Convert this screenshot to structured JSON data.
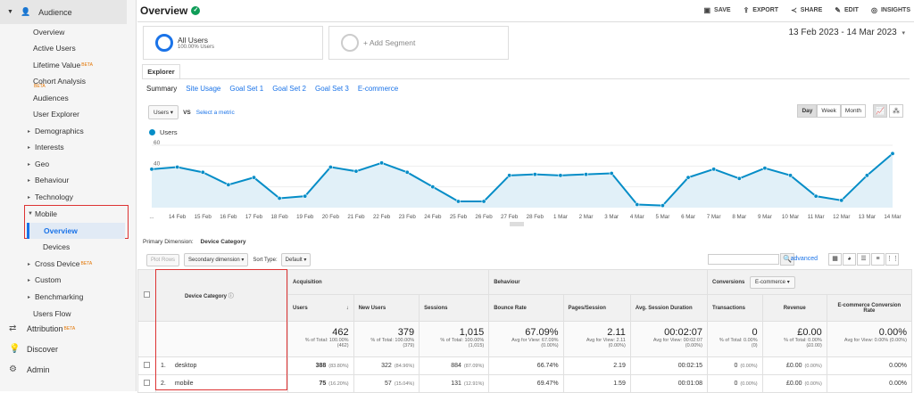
{
  "sidebar": {
    "section": "Audience",
    "items": [
      {
        "label": "Overview",
        "top": 27,
        "kind": "l1"
      },
      {
        "label": "Active Users",
        "top": 45,
        "kind": "l1"
      },
      {
        "label": "Lifetime Value",
        "top": 64,
        "kind": "l1",
        "beta": "BETA"
      },
      {
        "label": "Cohort Analysis",
        "top": 82,
        "kind": "l1",
        "beta": "BETA"
      },
      {
        "label": "Audiences",
        "top": 101,
        "kind": "l1"
      },
      {
        "label": "User Explorer",
        "top": 119,
        "kind": "l1"
      },
      {
        "label": "Demographics",
        "top": 138,
        "kind": "l1t"
      },
      {
        "label": "Interests",
        "top": 156,
        "kind": "l1t"
      },
      {
        "label": "Geo",
        "top": 175,
        "kind": "l1t"
      },
      {
        "label": "Behaviour",
        "top": 193,
        "kind": "l1t"
      },
      {
        "label": "Technology",
        "top": 212,
        "kind": "l1t"
      },
      {
        "label": "Devices",
        "top": 268,
        "kind": "l2"
      },
      {
        "label": "Cross Device",
        "top": 287,
        "kind": "l1t",
        "beta": "BETA"
      },
      {
        "label": "Custom",
        "top": 305,
        "kind": "l1t"
      },
      {
        "label": "Benchmarking",
        "top": 324,
        "kind": "l1t"
      },
      {
        "label": "Users Flow",
        "top": 343,
        "kind": "l1"
      }
    ],
    "mobile_label": "Mobile",
    "mobile_overview_label": "Overview",
    "bottom": [
      {
        "label": "Attribution",
        "beta": "BETA",
        "icon": "attribution-icon"
      },
      {
        "label": "Discover",
        "icon": "lightbulb-icon"
      },
      {
        "label": "Admin",
        "icon": "gear-icon"
      }
    ]
  },
  "header": {
    "title": "Overview",
    "actions": [
      "SAVE",
      "EXPORT",
      "SHARE",
      "EDIT",
      "INSIGHTS"
    ]
  },
  "segments": {
    "primary": {
      "name": "All Users",
      "sub": "100.00% Users"
    },
    "add_label": "+ Add Segment"
  },
  "date_range": "13 Feb 2023 - 14 Mar 2023",
  "explorer": {
    "tab": "Explorer",
    "subtabs": [
      "Summary",
      "Site Usage",
      "Goal Set 1",
      "Goal Set 2",
      "Goal Set 3",
      "E-commerce"
    ],
    "metric": "Users",
    "vs": "VS",
    "select_metric": "Select a metric",
    "periods": [
      "Day",
      "Week",
      "Month"
    ],
    "active_period": "Day"
  },
  "chart_data": {
    "type": "line",
    "series": [
      {
        "name": "Users",
        "color": "#058dc7",
        "values": [
          37,
          39,
          34,
          22,
          29,
          9,
          11,
          39,
          35,
          43,
          34,
          20,
          6,
          6,
          31,
          32,
          31,
          32,
          33,
          3,
          2,
          29,
          37,
          28,
          38,
          31,
          11,
          7,
          31,
          52
        ]
      }
    ],
    "x": [
      "13 Feb",
      "14 Feb",
      "15 Feb",
      "16 Feb",
      "17 Feb",
      "18 Feb",
      "19 Feb",
      "20 Feb",
      "21 Feb",
      "22 Feb",
      "23 Feb",
      "24 Feb",
      "25 Feb",
      "26 Feb",
      "27 Feb",
      "28 Feb",
      "1 Mar",
      "2 Mar",
      "3 Mar",
      "4 Mar",
      "5 Mar",
      "6 Mar",
      "7 Mar",
      "8 Mar",
      "9 Mar",
      "10 Mar",
      "11 Mar",
      "12 Mar",
      "13 Mar",
      "14 Mar"
    ],
    "x_tick_labels": [
      "...",
      "14 Feb",
      "15 Feb",
      "16 Feb",
      "17 Feb",
      "18 Feb",
      "19 Feb",
      "20 Feb",
      "21 Feb",
      "22 Feb",
      "23 Feb",
      "24 Feb",
      "25 Feb",
      "26 Feb",
      "27 Feb",
      "28 Feb",
      "1 Mar",
      "2 Mar",
      "3 Mar",
      "4 Mar",
      "5 Mar",
      "6 Mar",
      "7 Mar",
      "8 Mar",
      "9 Mar",
      "10 Mar",
      "11 Mar",
      "12 Mar",
      "13 Mar",
      "14 Mar"
    ],
    "y_ticks": [
      "60",
      "40",
      "20"
    ],
    "ylim": [
      0,
      60
    ]
  },
  "table": {
    "primary_dimension_label": "Primary Dimension:",
    "primary_dimension": "Device Category",
    "plot_rows": "Plot Rows",
    "secondary_dimension": "Secondary dimension",
    "sort_type_label": "Sort Type:",
    "sort_type": "Default",
    "advanced": "advanced",
    "group_headers": {
      "acquisition": "Acquisition",
      "behaviour": "Behaviour",
      "conversions": "Conversions",
      "conversions_select": "E-commerce"
    },
    "dimension_header": "Device Category",
    "columns": [
      "Users",
      "New Users",
      "Sessions",
      "Bounce Rate",
      "Pages/Session",
      "Avg. Session Duration",
      "Transactions",
      "Revenue",
      "E-commerce Conversion Rate"
    ],
    "totals": [
      {
        "big": "462",
        "sm": "% of Total: 100.00% (462)"
      },
      {
        "big": "379",
        "sm": "% of Total: 100.00% (379)"
      },
      {
        "big": "1,015",
        "sm": "% of Total: 100.00% (1,015)"
      },
      {
        "big": "67.09%",
        "sm": "Avg for View: 67.09% (0.00%)"
      },
      {
        "big": "2.11",
        "sm": "Avg for View: 2.11 (0.00%)"
      },
      {
        "big": "00:02:07",
        "sm": "Avg for View: 00:02:07 (0.00%)"
      },
      {
        "big": "0",
        "sm": "% of Total: 0.00% (0)"
      },
      {
        "big": "£0.00",
        "sm": "% of Total: 0.00% (£0.00)"
      },
      {
        "big": "0.00%",
        "sm": "Avg for View: 0.00% (0.00%)"
      }
    ],
    "rows": [
      {
        "num": "1.",
        "dim": "desktop",
        "cells": [
          [
            "388",
            "(83.80%)"
          ],
          [
            "322",
            "(84.96%)"
          ],
          [
            "884",
            "(87.09%)"
          ],
          [
            "66.74%",
            ""
          ],
          [
            "2.19",
            ""
          ],
          [
            "00:02:15",
            ""
          ],
          [
            "0",
            "(0.00%)"
          ],
          [
            "£0.00",
            "(0.00%)"
          ],
          [
            "0.00%",
            ""
          ]
        ]
      },
      {
        "num": "2.",
        "dim": "mobile",
        "cells": [
          [
            "75",
            "(16.20%)"
          ],
          [
            "57",
            "(15.04%)"
          ],
          [
            "131",
            "(12.91%)"
          ],
          [
            "69.47%",
            ""
          ],
          [
            "1.59",
            ""
          ],
          [
            "00:01:08",
            ""
          ],
          [
            "0",
            "(0.00%)"
          ],
          [
            "£0.00",
            "(0.00%)"
          ],
          [
            "0.00%",
            ""
          ]
        ]
      }
    ]
  }
}
